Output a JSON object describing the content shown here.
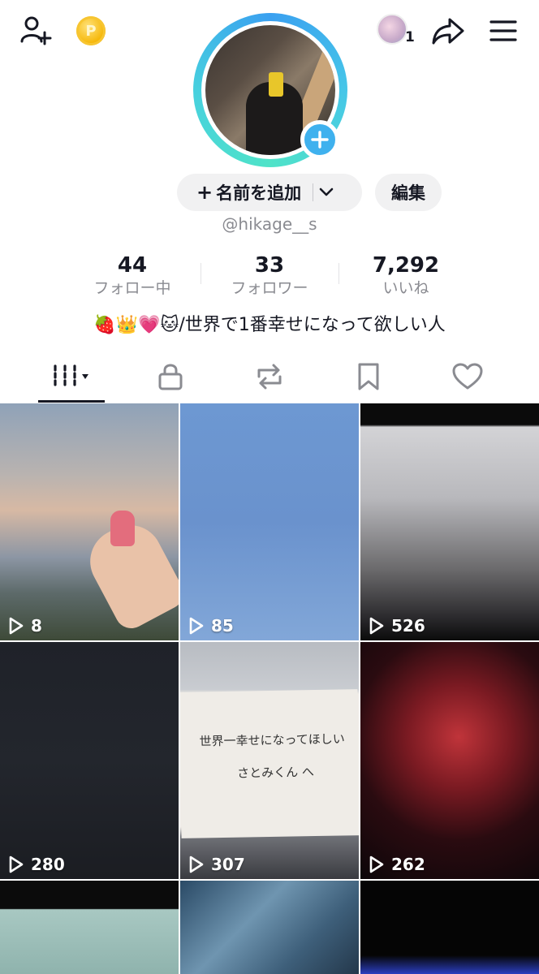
{
  "topbar": {
    "coin_letter": "P",
    "notification_count": "1"
  },
  "profile": {
    "name_button_label": "名前を追加",
    "edit_button_label": "編集",
    "username": "@hikage__s"
  },
  "stats": [
    {
      "value": "44",
      "label": "フォロー中"
    },
    {
      "value": "33",
      "label": "フォロワー"
    },
    {
      "value": "7,292",
      "label": "いいね"
    }
  ],
  "bio": "🍓👑💗🐱/世界で1番幸せになって欲しい人",
  "tabs": [
    {
      "icon": "videos-grid-icon",
      "selected": true
    },
    {
      "icon": "lock-icon",
      "selected": false
    },
    {
      "icon": "repost-icon",
      "selected": false
    },
    {
      "icon": "bookmark-icon",
      "selected": false
    },
    {
      "icon": "heart-icon",
      "selected": false
    }
  ],
  "videos": [
    {
      "views": "8"
    },
    {
      "views": "85"
    },
    {
      "views": "526"
    },
    {
      "views": "280"
    },
    {
      "views": "307"
    },
    {
      "views": "262"
    },
    {
      "views": ""
    },
    {
      "views": ""
    },
    {
      "views": ""
    }
  ],
  "note_text": {
    "line1": "世界一幸せになってほしい",
    "line2": "さとみくん へ"
  },
  "colors": {
    "accent_blue": "#3fb1ee",
    "text_primary": "#161823",
    "text_secondary": "#8a8b91",
    "pill_bg": "#f1f1f2"
  }
}
